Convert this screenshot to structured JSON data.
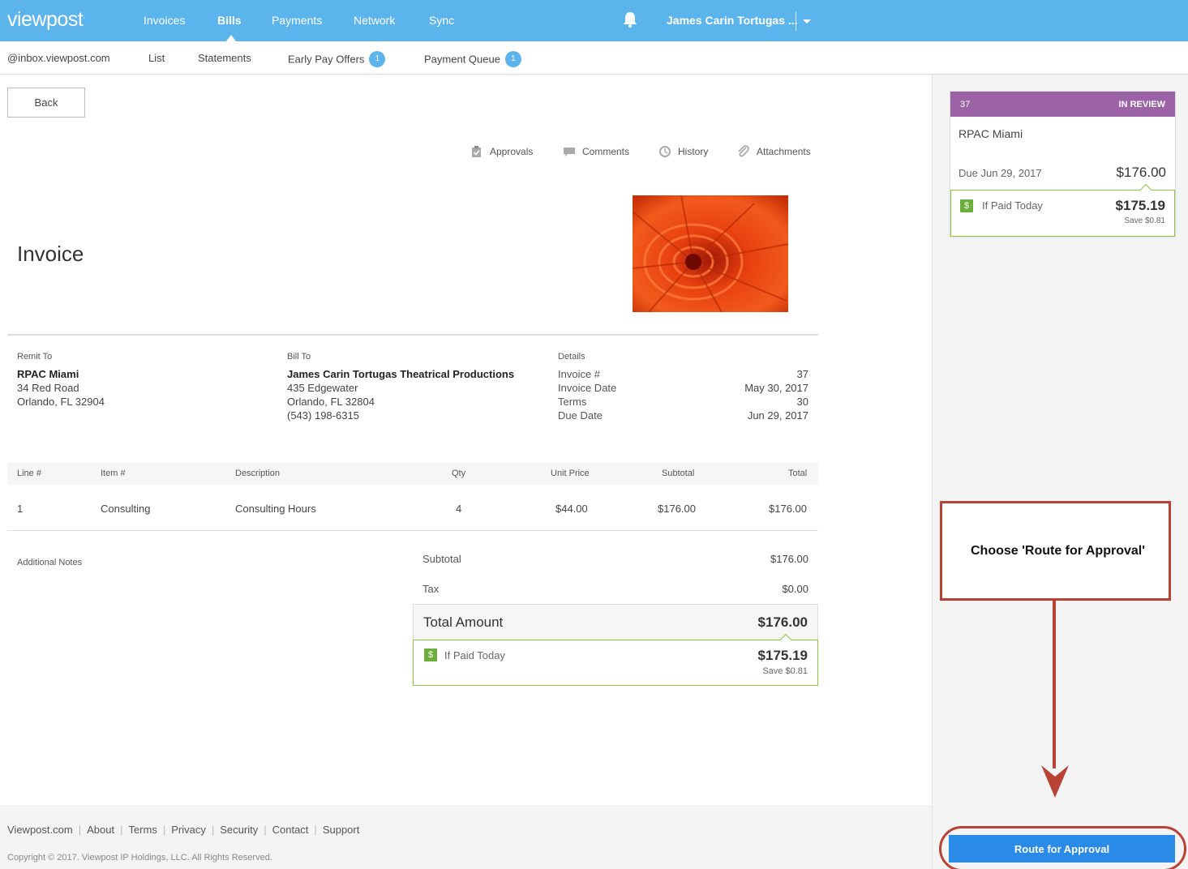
{
  "app": {
    "logo": "viewpost",
    "logo_mark": "."
  },
  "topnav": {
    "items": [
      "Invoices",
      "Bills",
      "Payments",
      "Network",
      "Sync"
    ],
    "active": "Bills",
    "user_name": "James Carin Tortugas ..."
  },
  "subnav": {
    "email": "@inbox.viewpost.com",
    "list": "List",
    "statements": "Statements",
    "early_pay": "Early Pay Offers",
    "early_pay_count": "1",
    "payment_queue": "Payment Queue",
    "payment_queue_count": "1"
  },
  "main": {
    "back_label": "Back",
    "tabs": {
      "approvals": "Approvals",
      "comments": "Comments",
      "history": "History",
      "attachments": "Attachments"
    },
    "title": "Invoice",
    "remit_to": {
      "label": "Remit To",
      "name": "RPAC Miami",
      "line1": "34 Red Road",
      "line2": "Orlando, FL 32904"
    },
    "bill_to": {
      "label": "Bill To",
      "name": "James Carin Tortugas Theatrical Productions",
      "line1": "435 Edgewater",
      "line2": "Orlando, FL 32804",
      "phone": "(543) 198-6315"
    },
    "details": {
      "label": "Details",
      "invoice_no_label": "Invoice #",
      "invoice_no": "37",
      "invoice_date_label": "Invoice Date",
      "invoice_date": "May 30, 2017",
      "terms_label": "Terms",
      "terms": "30",
      "due_date_label": "Due Date",
      "due_date": "Jun 29, 2017"
    },
    "table": {
      "headers": {
        "line": "Line #",
        "item": "Item #",
        "description": "Description",
        "qty": "Qty",
        "unit_price": "Unit Price",
        "subtotal": "Subtotal",
        "total": "Total"
      },
      "rows": [
        {
          "line": "1",
          "item": "Consulting",
          "description": "Consulting Hours",
          "qty": "4",
          "unit_price": "$44.00",
          "subtotal": "$176.00",
          "total": "$176.00"
        }
      ]
    },
    "additional_notes": "Additional Notes",
    "summary": {
      "subtotal_label": "Subtotal",
      "subtotal": "$176.00",
      "tax_label": "Tax",
      "tax": "$0.00",
      "total_label": "Total Amount",
      "total": "$176.00",
      "if_paid_label": "If Paid Today",
      "if_paid": "$175.19",
      "save": "Save $0.81",
      "dollar_symbol": "$"
    }
  },
  "sidebar": {
    "card": {
      "number": "37",
      "status": "IN REVIEW",
      "vendor": "RPAC Miami",
      "due": "Due Jun 29, 2017",
      "amount": "$176.00",
      "if_paid_label": "If Paid Today",
      "if_paid": "$175.19",
      "save": "Save $0.81",
      "dollar_symbol": "$"
    },
    "callout": "Choose 'Route for Approval'",
    "route_button": "Route for Approval"
  },
  "footer": {
    "links": [
      "Viewpost.com",
      "About",
      "Terms",
      "Privacy",
      "Security",
      "Contact",
      "Support"
    ],
    "copyright": "Copyright © 2017. Viewpost IP Holdings, LLC. All Rights Reserved."
  },
  "colors": {
    "topbar": "#5cb4ec",
    "status_purple": "#9b62a6",
    "paid_green": "#8cc63f",
    "button_blue": "#2a8ae8",
    "annotation_red": "#b84233"
  }
}
